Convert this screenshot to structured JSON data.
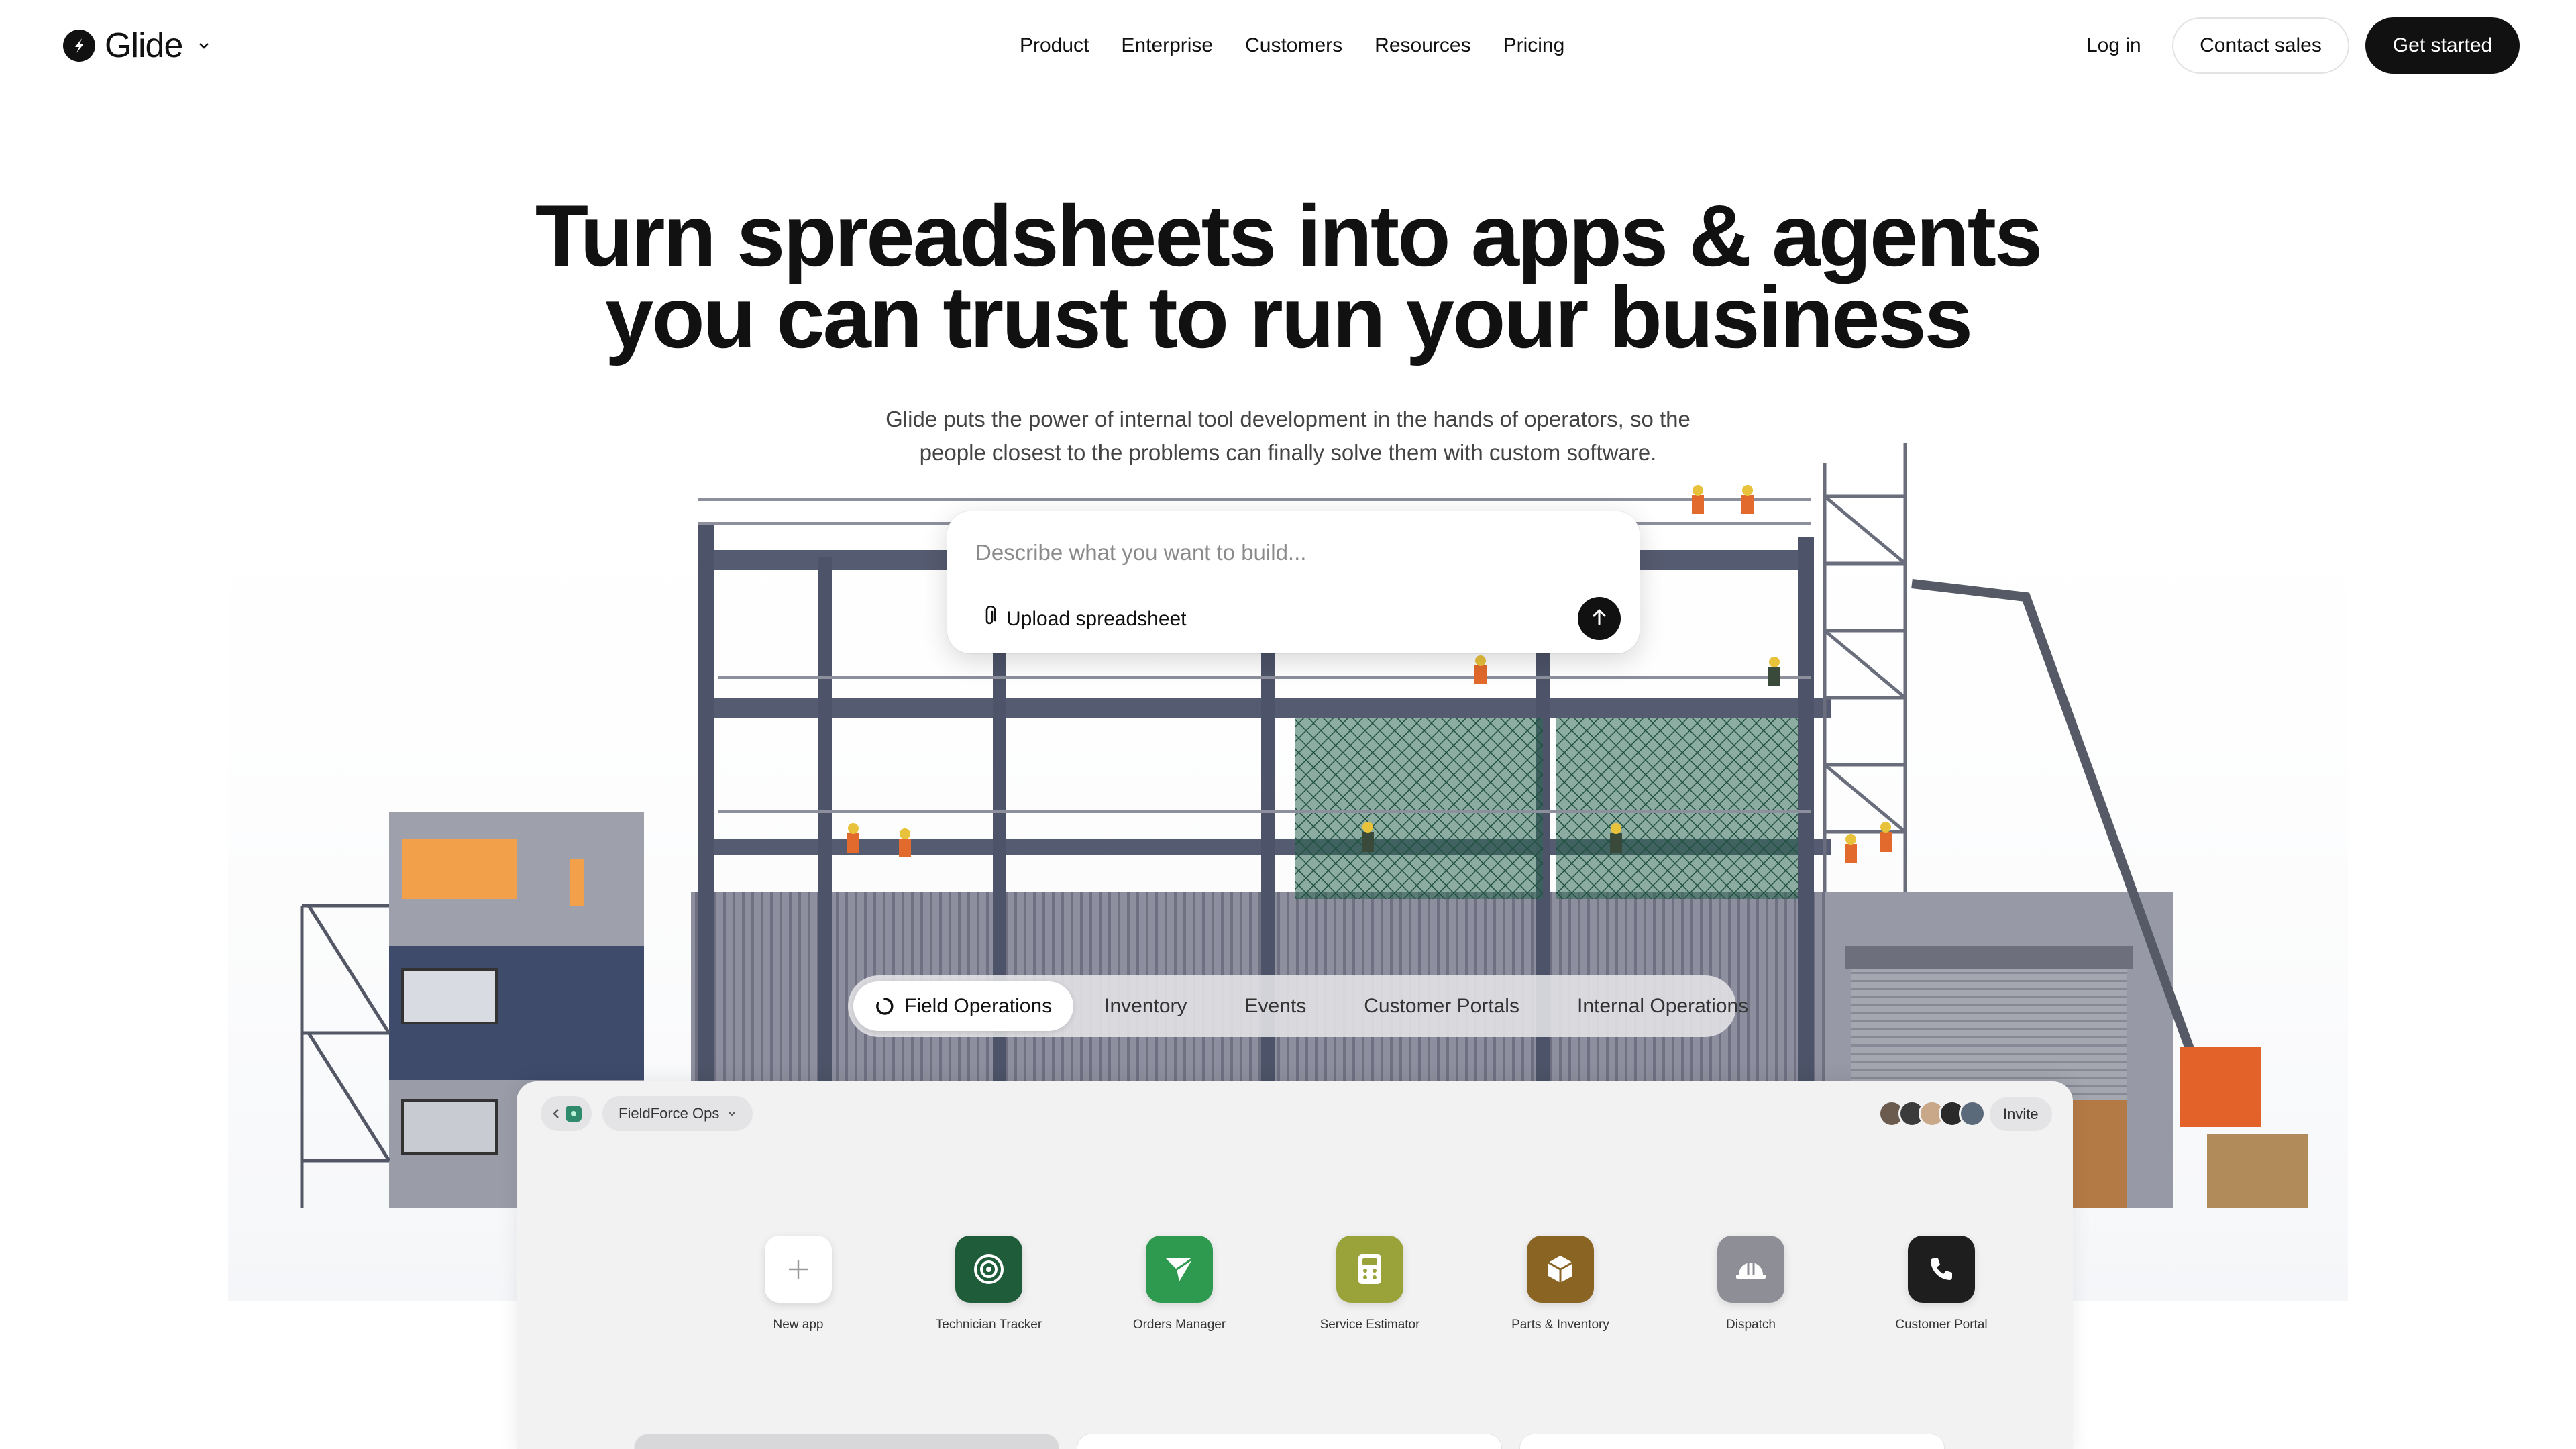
{
  "nav": {
    "logo_text": "Glide",
    "links": [
      "Product",
      "Enterprise",
      "Customers",
      "Resources",
      "Pricing"
    ],
    "login": "Log in",
    "contact": "Contact sales",
    "start": "Get started"
  },
  "hero": {
    "title_line1": "Turn spreadsheets into apps & agents",
    "title_line2": "you can trust to run your business",
    "subtitle_line1": "Glide puts the power of internal tool development in the hands of operators, so the",
    "subtitle_line2": "people closest to the problems can finally solve them with custom software."
  },
  "prompt": {
    "placeholder": "Describe what you want to build...",
    "upload_label": "Upload spreadsheet"
  },
  "tabs": {
    "items": [
      "Field Operations",
      "Inventory",
      "Events",
      "Customer Portals",
      "Internal Operations"
    ],
    "active": "Field Operations"
  },
  "window": {
    "workspace": "FieldForce Ops",
    "invite": "Invite",
    "apps": [
      {
        "label": "New app",
        "icon": "plus-icon",
        "color": "#ffffff"
      },
      {
        "label": "Technician Tracker",
        "icon": "radar-icon",
        "color": "#1f5c3a"
      },
      {
        "label": "Orders Manager",
        "icon": "send-icon",
        "color": "#2e9a4f"
      },
      {
        "label": "Service Estimator",
        "icon": "calculator-icon",
        "color": "#9aa33a"
      },
      {
        "label": "Parts & Inventory",
        "icon": "box-icon",
        "color": "#8a6422"
      },
      {
        "label": "Dispatch",
        "icon": "hardhat-icon",
        "color": "#8e8f96"
      },
      {
        "label": "Customer Portal",
        "icon": "phone-icon",
        "color": "#1e1e1e"
      }
    ]
  },
  "colors": {
    "primary": "#111111",
    "background": "#ffffff"
  }
}
